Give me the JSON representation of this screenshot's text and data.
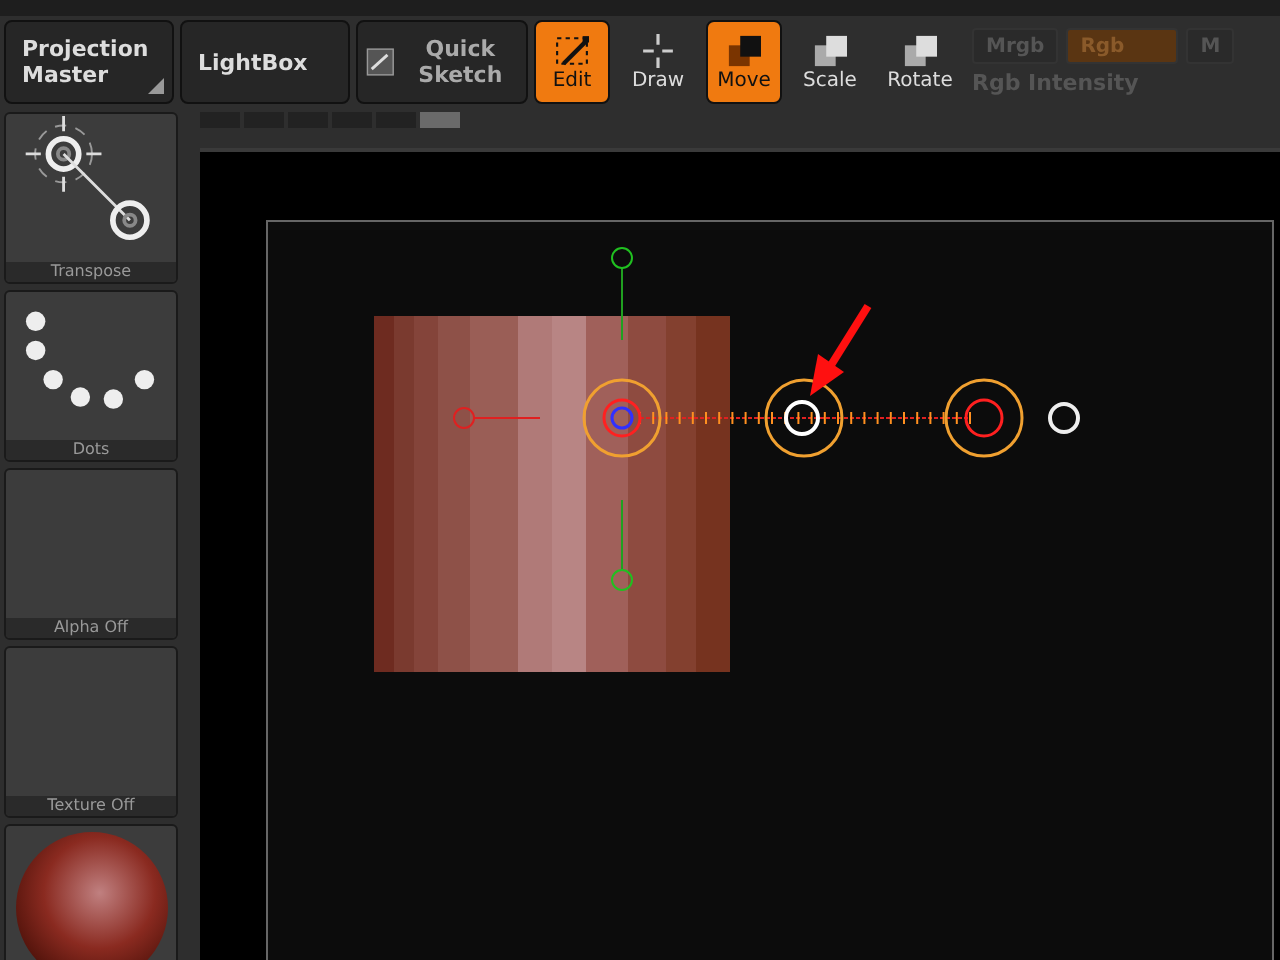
{
  "toolbar": {
    "buttons": [
      {
        "label": "Projection Master",
        "kind": "wide",
        "selected": false
      },
      {
        "label": "LightBox",
        "kind": "wide",
        "selected": false
      },
      {
        "label": "Quick Sketch",
        "kind": "sketch",
        "selected": false
      },
      {
        "label": "Edit",
        "kind": "edit",
        "selected": true
      },
      {
        "label": "Draw",
        "kind": "draw",
        "selected": false
      },
      {
        "label": "Move",
        "kind": "move",
        "selected": true
      },
      {
        "label": "Scale",
        "kind": "scale",
        "selected": false
      },
      {
        "label": "Rotate",
        "kind": "rotate",
        "selected": false
      }
    ],
    "color_mode": [
      {
        "label": "Mrgb",
        "selected": false
      },
      {
        "label": "Rgb",
        "selected": true
      },
      {
        "label": "M",
        "selected": false
      }
    ],
    "intensity_label": "Rgb Intensity"
  },
  "tray": [
    {
      "label": "Transpose",
      "kind": "transpose"
    },
    {
      "label": "Dots",
      "kind": "dots"
    },
    {
      "label": "Alpha Off",
      "kind": "empty"
    },
    {
      "label": "Texture Off",
      "kind": "empty"
    },
    {
      "kind": "material"
    }
  ],
  "strip": {
    "tabs": [
      {
        "selected": false
      },
      {
        "selected": false
      },
      {
        "selected": false
      },
      {
        "selected": false
      },
      {
        "selected": false
      },
      {
        "selected": true
      }
    ]
  }
}
